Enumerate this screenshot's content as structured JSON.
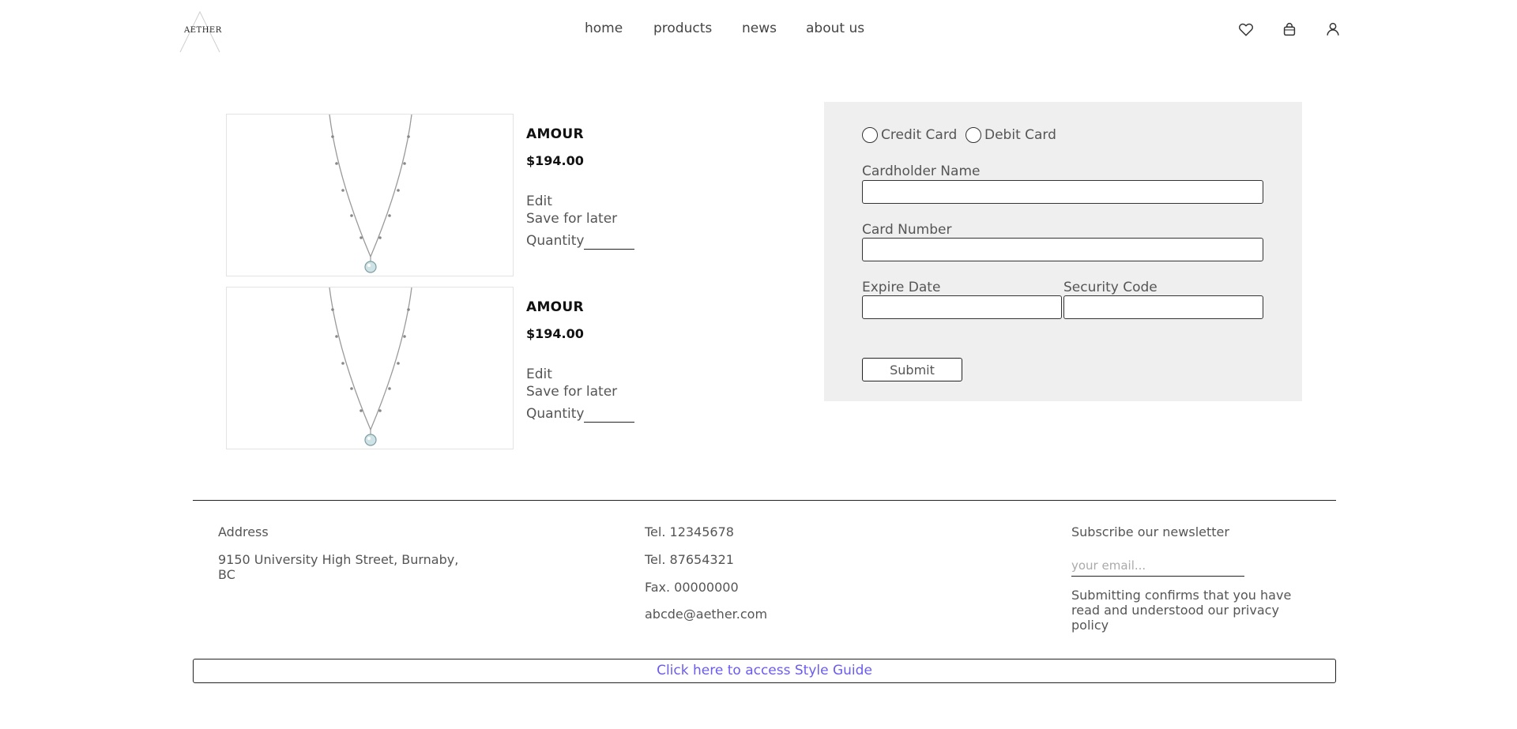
{
  "header": {
    "logo_text": "AETHER",
    "nav": [
      {
        "label": "home"
      },
      {
        "label": "products"
      },
      {
        "label": "news"
      },
      {
        "label": "about us"
      }
    ],
    "icons": [
      "heart-icon",
      "shopping-bag-icon",
      "user-icon"
    ]
  },
  "cart": {
    "items": [
      {
        "name": "AMOUR",
        "price": "$194.00",
        "edit_label": "Edit",
        "save_label": "Save for later",
        "quantity_label": "Quantity",
        "quantity_value": ""
      },
      {
        "name": "AMOUR",
        "price": "$194.00",
        "edit_label": "Edit",
        "save_label": "Save for later",
        "quantity_label": "Quantity",
        "quantity_value": ""
      }
    ]
  },
  "payment": {
    "options": [
      {
        "label": "Credit Card",
        "selected": false
      },
      {
        "label": "Debit Card",
        "selected": false
      }
    ],
    "cardholder_label": "Cardholder Name",
    "cardholder_value": "",
    "card_number_label": "Card Number",
    "card_number_value": "",
    "expire_label": "Expire Date",
    "expire_value": "",
    "security_label": "Security Code",
    "security_value": "",
    "submit_label": "Submit"
  },
  "footer": {
    "address_heading": "Address",
    "address_line1": "9150 University High Street, Burnaby,",
    "address_line2": "BC",
    "tel1": "Tel. 12345678",
    "tel2": "Tel. 87654321",
    "fax": "Fax. 00000000",
    "email": "abcde@aether.com",
    "newsletter_heading": "Subscribe our newsletter",
    "newsletter_placeholder": "your email...",
    "fine_print": "Submitting confirms that you have read and understood our privacy policy",
    "style_guide_link": "Click here to access Style Guide"
  },
  "colors": {
    "text": "#444444",
    "heading": "#111111",
    "panel_bg": "#efefef",
    "link": "#6b5cf0",
    "border": "#222222"
  }
}
